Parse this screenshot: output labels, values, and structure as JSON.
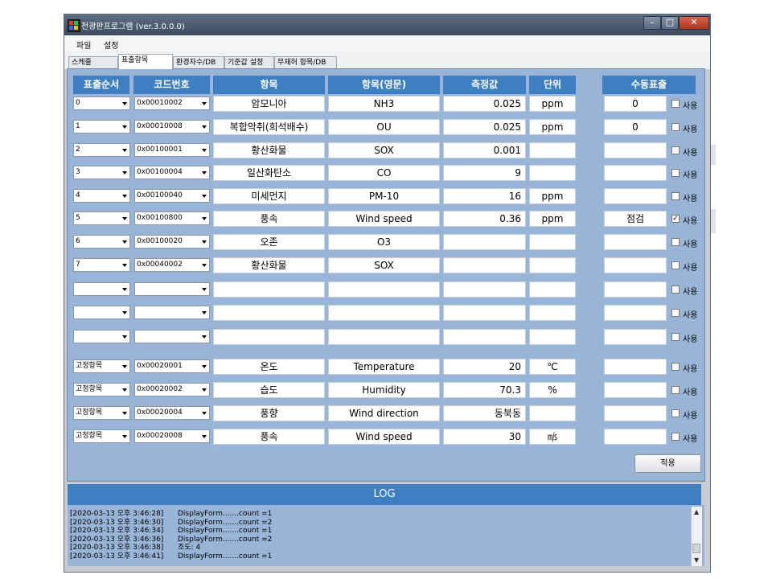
{
  "window": {
    "title": "전광판프로그램 (ver.3.0.0.0)",
    "minimize_glyph": "–",
    "maximize_glyph": "□",
    "close_glyph": "✕"
  },
  "menu": [
    "파일",
    "설정"
  ],
  "tabs": [
    "스케줄",
    "표출항목",
    "환경자수/DB",
    "기준값 설정",
    "무재허 항목/DB"
  ],
  "active_tab": 1,
  "table": {
    "headers": [
      "표출순서",
      "코드번호",
      "항목",
      "항목(영문)",
      "측정값",
      "단위",
      "수동표출"
    ],
    "use_label": "사용",
    "rows": [
      {
        "order": "0",
        "code": "0x00010002",
        "item": "암모니아",
        "item_en": "NH3",
        "value": "0.025",
        "unit": "ppm",
        "manual": "0",
        "checked": false
      },
      {
        "order": "1",
        "code": "0x00010008",
        "item": "복합악취(희석배수)",
        "item_en": "OU",
        "value": "0.025",
        "unit": "ppm",
        "manual": "0",
        "checked": false
      },
      {
        "order": "2",
        "code": "0x00100001",
        "item": "황산화물",
        "item_en": "SOX",
        "value": "0.001",
        "unit": "",
        "manual": "",
        "checked": false
      },
      {
        "order": "3",
        "code": "0x00100004",
        "item": "일산화탄소",
        "item_en": "CO",
        "value": "9",
        "unit": "",
        "manual": "",
        "checked": false
      },
      {
        "order": "4",
        "code": "0x00100040",
        "item": "미세먼지",
        "item_en": "PM-10",
        "value": "16",
        "unit": "ppm",
        "manual": "",
        "checked": false
      },
      {
        "order": "5",
        "code": "0x00100800",
        "item": "풍속",
        "item_en": "Wind speed",
        "value": "0.36",
        "unit": "ppm",
        "manual": "점검",
        "checked": true
      },
      {
        "order": "6",
        "code": "0x00100020",
        "item": "오존",
        "item_en": "O3",
        "value": "",
        "unit": "",
        "manual": "",
        "checked": false
      },
      {
        "order": "7",
        "code": "0x00040002",
        "item": "황산화물",
        "item_en": "SOX",
        "value": "",
        "unit": "",
        "manual": "",
        "checked": false
      },
      {
        "order": "",
        "code": "",
        "item": "",
        "item_en": "",
        "value": "",
        "unit": "",
        "manual": "",
        "checked": false
      },
      {
        "order": "",
        "code": "",
        "item": "",
        "item_en": "",
        "value": "",
        "unit": "",
        "manual": "",
        "checked": false
      },
      {
        "order": "",
        "code": "",
        "item": "",
        "item_en": "",
        "value": "",
        "unit": "",
        "manual": "",
        "checked": false
      }
    ],
    "fixed_rows": [
      {
        "order": "고정항목",
        "code": "0x00020001",
        "item": "온도",
        "item_en": "Temperature",
        "value": "20",
        "unit": "℃",
        "manual": "",
        "checked": false
      },
      {
        "order": "고정항목",
        "code": "0x00020002",
        "item": "습도",
        "item_en": "Humidity",
        "value": "70.3",
        "unit": "%",
        "manual": "",
        "checked": false
      },
      {
        "order": "고정항목",
        "code": "0x00020004",
        "item": "풍향",
        "item_en": "Wind direction",
        "value": "동북동",
        "unit": "",
        "manual": "",
        "checked": false
      },
      {
        "order": "고정항목",
        "code": "0x00020008",
        "item": "풍속",
        "item_en": "Wind speed",
        "value": "30",
        "unit": "㎧",
        "manual": "",
        "checked": false
      }
    ]
  },
  "apply_button": "적용",
  "log": {
    "title": "LOG",
    "lines": [
      {
        "ts": "[2020-03-13 오후 3:46:28]",
        "msg": "DisplayForm.......count =1"
      },
      {
        "ts": "[2020-03-13 오후 3:46:30]",
        "msg": "DisplayForm.......count =2"
      },
      {
        "ts": "[2020-03-13 오후 3:46:34]",
        "msg": "DisplayForm.......count =1"
      },
      {
        "ts": "[2020-03-13 오후 3:46:36]",
        "msg": "DisplayForm.......count =2"
      },
      {
        "ts": "[2020-03-13 오후 3:46:38]",
        "msg": "조도: 4"
      },
      {
        "ts": "[2020-03-13 오후 3:46:41]",
        "msg": "DisplayForm.......count =1"
      }
    ]
  },
  "colors": {
    "header_blue": "#3d7fc1",
    "panel_blue": "#98b4d6",
    "titlebar": "#3e4a5c"
  }
}
